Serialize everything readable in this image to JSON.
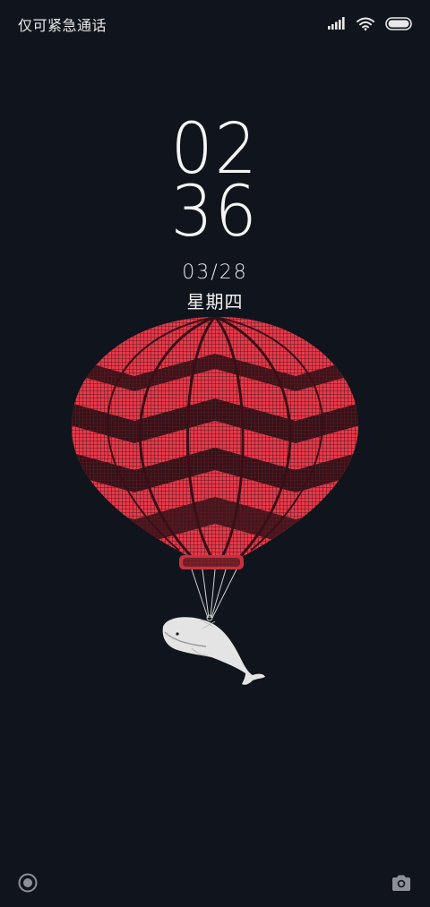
{
  "status_bar": {
    "carrier_text": "仅可紧急通话",
    "icons": [
      "signal-icon",
      "wifi-icon",
      "battery-icon"
    ]
  },
  "lockscreen": {
    "hour": "02",
    "minute": "36",
    "date": "03/28",
    "weekday": "星期四"
  },
  "wallpaper": {
    "description_icon": "hot-air-balloon-whale-illustration",
    "balloon_color": "#e8394a",
    "background_color": "#10141c"
  },
  "bottom_bar": {
    "left_icon": "assistant-circle-icon",
    "right_icon": "camera-icon"
  }
}
